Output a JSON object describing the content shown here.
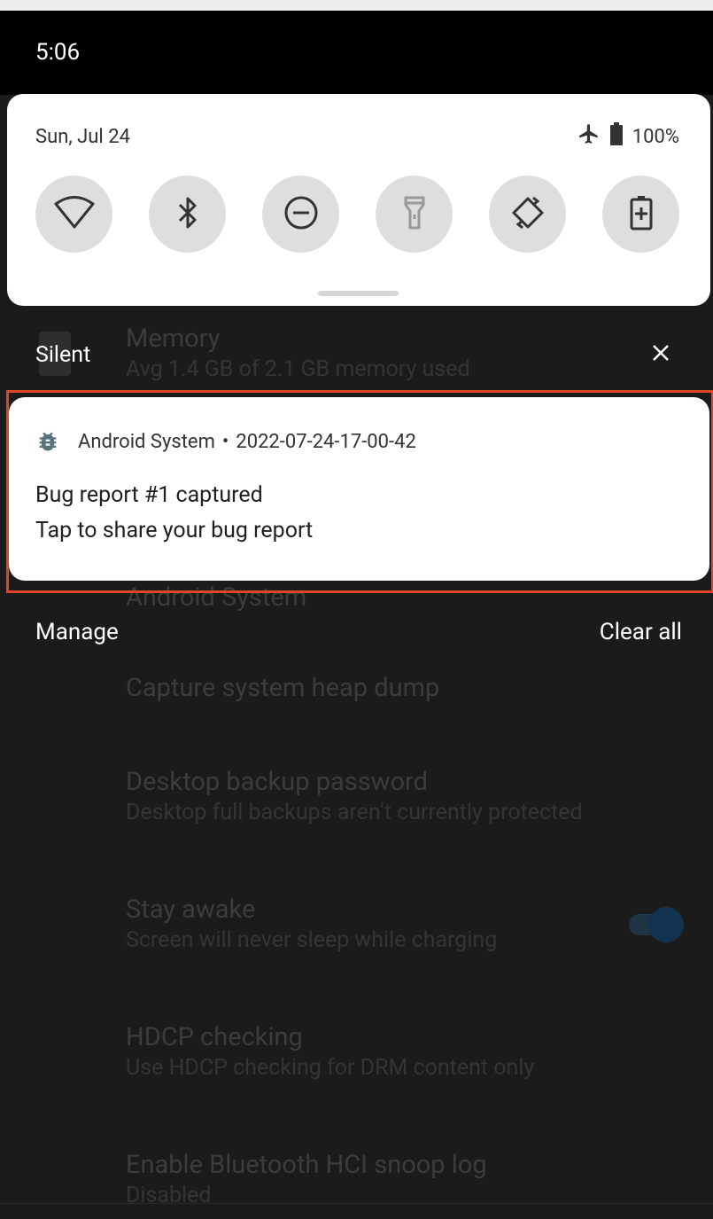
{
  "status_bar": {
    "time": "5:06"
  },
  "quick_settings": {
    "date": "Sun, Jul 24",
    "battery": "100%",
    "tiles": [
      "wifi-icon",
      "bluetooth-icon",
      "do-not-disturb-icon",
      "flashlight-icon",
      "auto-rotate-icon",
      "battery-saver-icon"
    ]
  },
  "background_settings": {
    "memory_title": "Memory",
    "memory_sub": "Avg 1.4 GB of 2.1 GB memory used",
    "android_system_partial": "Android System",
    "heap_dump": "Capture system heap dump",
    "desktop_backup_title": "Desktop backup password",
    "desktop_backup_sub": "Desktop full backups aren’t currently protected",
    "stay_awake_title": "Stay awake",
    "stay_awake_sub": "Screen will never sleep while charging",
    "hdcp_title": "HDCP checking",
    "hdcp_sub": "Use HDCP checking for DRM content only",
    "bt_snoop_title": "Enable Bluetooth HCI snoop log",
    "bt_snoop_sub": "Disabled"
  },
  "notifications": {
    "section_label": "Silent",
    "card": {
      "app_name": "Android System",
      "separator": "•",
      "timestamp": "2022-07-24-17-00-42",
      "title": "Bug report #1 captured",
      "text": "Tap to share your bug report"
    },
    "manage_label": "Manage",
    "clear_all_label": "Clear all"
  },
  "colors": {
    "highlight": "#e0452a",
    "accent": "#13324f"
  }
}
